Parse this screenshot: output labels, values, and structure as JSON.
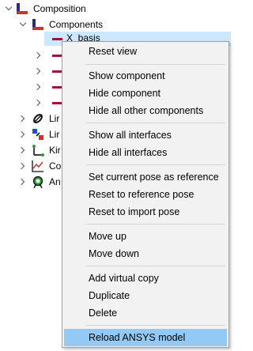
{
  "tree": {
    "composition_label": "Composition",
    "components_label": "Components",
    "selected_item_label": "X_basis",
    "truncated_items": [
      "Lir",
      "Lir",
      "Kir",
      "Co",
      "An"
    ]
  },
  "context_menu": {
    "items": [
      "Reset view",
      "Show component",
      "Hide component",
      "Hide all other components",
      "Show all interfaces",
      "Hide all interfaces",
      "Set current pose as reference",
      "Reset to reference pose",
      "Reset to import pose",
      "Move up",
      "Move down",
      "Add virtual copy",
      "Duplicate",
      "Delete",
      "Reload ANSYS model"
    ]
  },
  "colors": {
    "selection": "#cce8ff",
    "menu_highlight": "#91c9f7",
    "menu_background": "#f2f2f2",
    "component_dash": "#a01040"
  }
}
